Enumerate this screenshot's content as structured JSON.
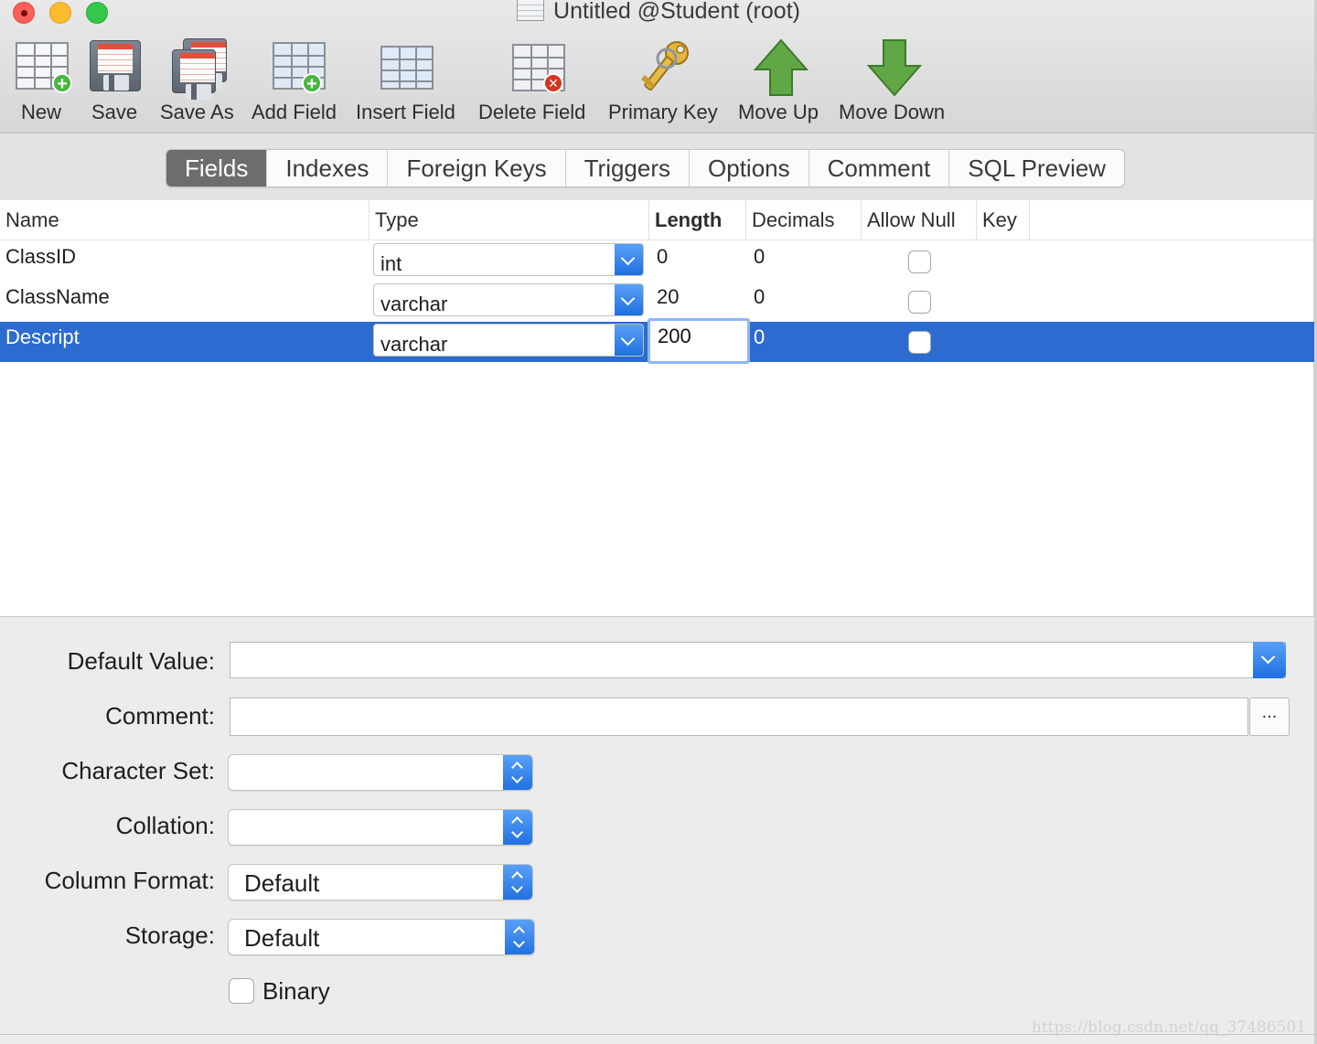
{
  "window": {
    "title": "Untitled @Student (root)"
  },
  "toolbar": {
    "new": "New",
    "save": "Save",
    "save_as": "Save As",
    "add_field": "Add Field",
    "insert_field": "Insert Field",
    "delete_field": "Delete Field",
    "primary_key": "Primary Key",
    "move_up": "Move Up",
    "move_down": "Move Down"
  },
  "tabs": [
    "Fields",
    "Indexes",
    "Foreign Keys",
    "Triggers",
    "Options",
    "Comment",
    "SQL Preview"
  ],
  "active_tab": "Fields",
  "table": {
    "headers": [
      "Name",
      "Type",
      "Length",
      "Decimals",
      "Allow Null",
      "Key"
    ],
    "rows": [
      {
        "name": "ClassID",
        "type": "int",
        "length": "0",
        "decimals": "0",
        "allow_null": false
      },
      {
        "name": "ClassName",
        "type": "varchar",
        "length": "20",
        "decimals": "0",
        "allow_null": false
      },
      {
        "name": "Descript",
        "type": "varchar",
        "length": "200",
        "decimals": "0",
        "allow_null": false,
        "selected": true
      }
    ]
  },
  "properties": {
    "default_value_label": "Default Value:",
    "default_value": "",
    "comment_label": "Comment:",
    "comment": "",
    "comment_button": "...",
    "character_set_label": "Character Set:",
    "character_set": "",
    "collation_label": "Collation:",
    "collation": "",
    "column_format_label": "Column Format:",
    "column_format": "Default",
    "storage_label": "Storage:",
    "storage": "Default",
    "binary_label": "Binary",
    "binary": false
  },
  "watermark": "https://blog.csdn.net/qq_37486501",
  "colors": {
    "selection": "#2c6bd0",
    "accent": "#1e6fe0",
    "active_tab": "#6d6d6d"
  }
}
